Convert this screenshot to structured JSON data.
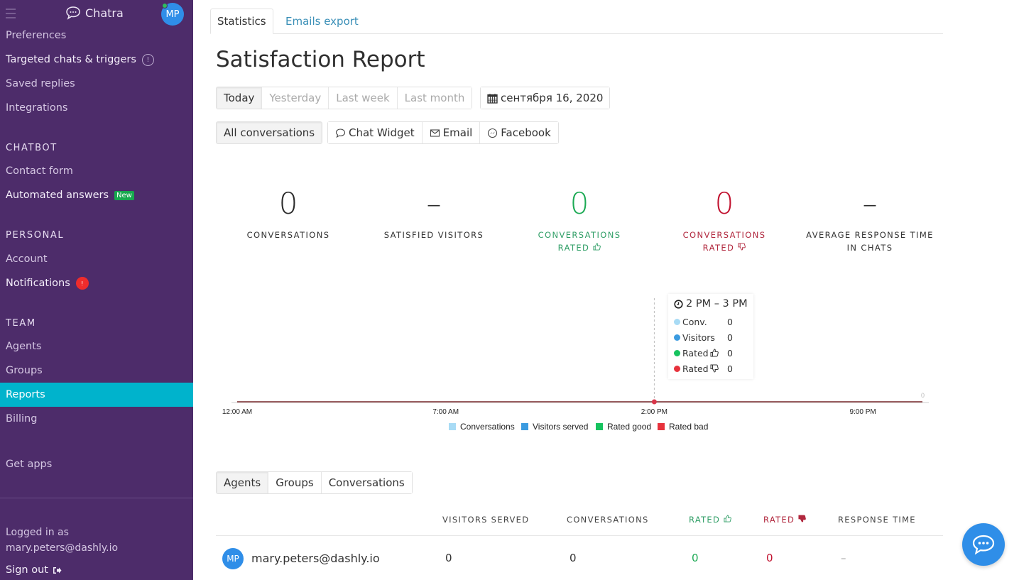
{
  "sidebar": {
    "brand": "Chatra",
    "user_initials": "MP",
    "items": [
      {
        "label": "Preferences"
      },
      {
        "label": "Targeted chats & triggers",
        "info": "!"
      },
      {
        "label": "Saved replies"
      },
      {
        "label": "Integrations"
      }
    ],
    "sections": {
      "chatbot": "CHATBOT",
      "personal": "PERSONAL",
      "team": "TEAM"
    },
    "chatbot_items": [
      {
        "label": "Contact form"
      },
      {
        "label": "Automated answers",
        "badge": "New"
      }
    ],
    "personal_items": [
      {
        "label": "Account"
      },
      {
        "label": "Notifications",
        "badge": "!"
      }
    ],
    "team_items": [
      {
        "label": "Agents"
      },
      {
        "label": "Groups"
      },
      {
        "label": "Reports",
        "active": true
      },
      {
        "label": "Billing"
      }
    ],
    "get_apps": "Get apps",
    "logged_in_label": "Logged in as",
    "logged_in_email": "mary.peters@dashly.io",
    "sign_out": "Sign out"
  },
  "tabs": [
    {
      "label": "Statistics",
      "active": true
    },
    {
      "label": "Emails export"
    }
  ],
  "page_title": "Satisfaction Report",
  "period_filters": [
    {
      "label": "Today",
      "selected": true
    },
    {
      "label": "Yesterday"
    },
    {
      "label": "Last week"
    },
    {
      "label": "Last month"
    }
  ],
  "date_picker": "сентября 16, 2020",
  "channel_filters": {
    "all": "All conversations",
    "channels": [
      {
        "label": "Chat Widget",
        "icon": "chat-bubble-icon"
      },
      {
        "label": "Email",
        "icon": "envelope-icon"
      },
      {
        "label": "Facebook",
        "icon": "messenger-icon"
      }
    ]
  },
  "stats": [
    {
      "value": "0",
      "label": "CONVERSATIONS"
    },
    {
      "value": "–",
      "label": "SATISFIED VISITORS"
    },
    {
      "value": "0",
      "label_line1": "CONVERSATIONS",
      "label_line2": "RATED"
    },
    {
      "value": "0",
      "label_line1": "CONVERSATIONS",
      "label_line2": "RATED"
    },
    {
      "value": "–",
      "label_line1": "AVERAGE RESPONSE TIME",
      "label_line2": "IN CHATS"
    }
  ],
  "colors": {
    "sidebar_bg": "#4d2c6a",
    "active_item": "#00b3cc",
    "good": "#1daa55",
    "bad": "#c1122f",
    "conversations": "#a8dbf5",
    "visitors": "#3b9be0",
    "rated_good": "#17c35f",
    "rated_bad": "#e7323c"
  },
  "chart_data": {
    "type": "line",
    "title": "",
    "xlabel": "",
    "ylabel": "",
    "x_ticks": [
      "12:00 AM",
      "7:00 AM",
      "2:00 PM",
      "9:00 PM"
    ],
    "x_hours": [
      0,
      1,
      2,
      3,
      4,
      5,
      6,
      7,
      8,
      9,
      10,
      11,
      12,
      13,
      14,
      15,
      16,
      17,
      18,
      19,
      20,
      21,
      22,
      23
    ],
    "y_tick": "0",
    "ylim": [
      0,
      1
    ],
    "series": [
      {
        "name": "Conversations",
        "values": [
          0,
          0,
          0,
          0,
          0,
          0,
          0,
          0,
          0,
          0,
          0,
          0,
          0,
          0,
          0,
          0,
          0,
          0,
          0,
          0,
          0,
          0,
          0,
          0
        ]
      },
      {
        "name": "Visitors served",
        "values": [
          0,
          0,
          0,
          0,
          0,
          0,
          0,
          0,
          0,
          0,
          0,
          0,
          0,
          0,
          0,
          0,
          0,
          0,
          0,
          0,
          0,
          0,
          0,
          0
        ]
      },
      {
        "name": "Rated good",
        "values": [
          0,
          0,
          0,
          0,
          0,
          0,
          0,
          0,
          0,
          0,
          0,
          0,
          0,
          0,
          0,
          0,
          0,
          0,
          0,
          0,
          0,
          0,
          0,
          0
        ]
      },
      {
        "name": "Rated bad",
        "values": [
          0,
          0,
          0,
          0,
          0,
          0,
          0,
          0,
          0,
          0,
          0,
          0,
          0,
          0,
          0,
          0,
          0,
          0,
          0,
          0,
          0,
          0,
          0,
          0
        ]
      }
    ],
    "legend": [
      "Conversations",
      "Visitors served",
      "Rated good",
      "Rated bad"
    ],
    "legend_position": "bottom",
    "highlight_hour": 14,
    "tooltip": {
      "title": "2 PM – 3 PM",
      "rows": [
        {
          "label": "Conv.",
          "value": "0"
        },
        {
          "label": "Visitors",
          "value": "0"
        },
        {
          "label": "Rated",
          "value": "0"
        },
        {
          "label": "Rated",
          "value": "0"
        }
      ]
    }
  },
  "breakdown_tabs": [
    {
      "label": "Agents",
      "selected": true
    },
    {
      "label": "Groups"
    },
    {
      "label": "Conversations"
    }
  ],
  "table": {
    "columns": [
      "VISITORS SERVED",
      "CONVERSATIONS",
      "RATED",
      "RATED",
      "RESPONSE TIME"
    ],
    "rows": [
      {
        "initials": "MP",
        "agent": "mary.peters@dashly.io",
        "visitors_served": "0",
        "conversations": "0",
        "rated_good": "0",
        "rated_bad": "0",
        "response_time": "–"
      }
    ]
  }
}
